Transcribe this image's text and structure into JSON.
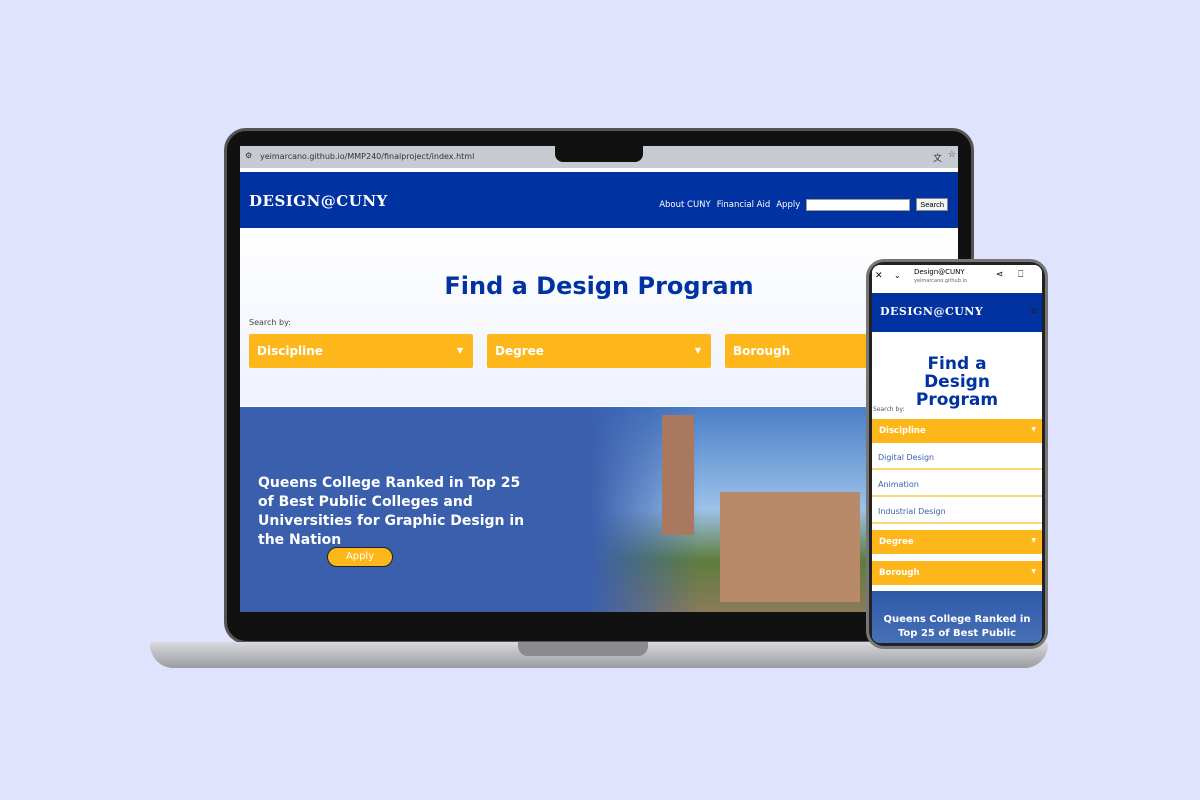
{
  "browser": {
    "url": "yeimarcano.github.io/MMP240/finalproject/index.html"
  },
  "site": {
    "logo": "DESIGN@CUNY",
    "nav": [
      "About CUNY",
      "Financial Aid",
      "Apply"
    ],
    "search_button": "Search",
    "title": "Find a Design Program",
    "search_by": "Search by:",
    "filters": [
      "Discipline",
      "Degree",
      "Borough"
    ],
    "banner_text": "Queens College Ranked in Top 25 of Best Public Colleges and Universities for Graphic Design in the Nation",
    "apply_button": "Apply"
  },
  "mobile": {
    "tab_title": "Design@CUNY",
    "domain": "yeimarcano.github.io",
    "title": "Find a Design Program",
    "search_by": "Search by:",
    "filters": [
      "Discipline",
      "Degree",
      "Borough"
    ],
    "discipline_options": [
      "Digital Design",
      "Animation",
      "Industrial Design"
    ],
    "banner_text": "Queens College Ranked in Top 25 of Best Public"
  }
}
